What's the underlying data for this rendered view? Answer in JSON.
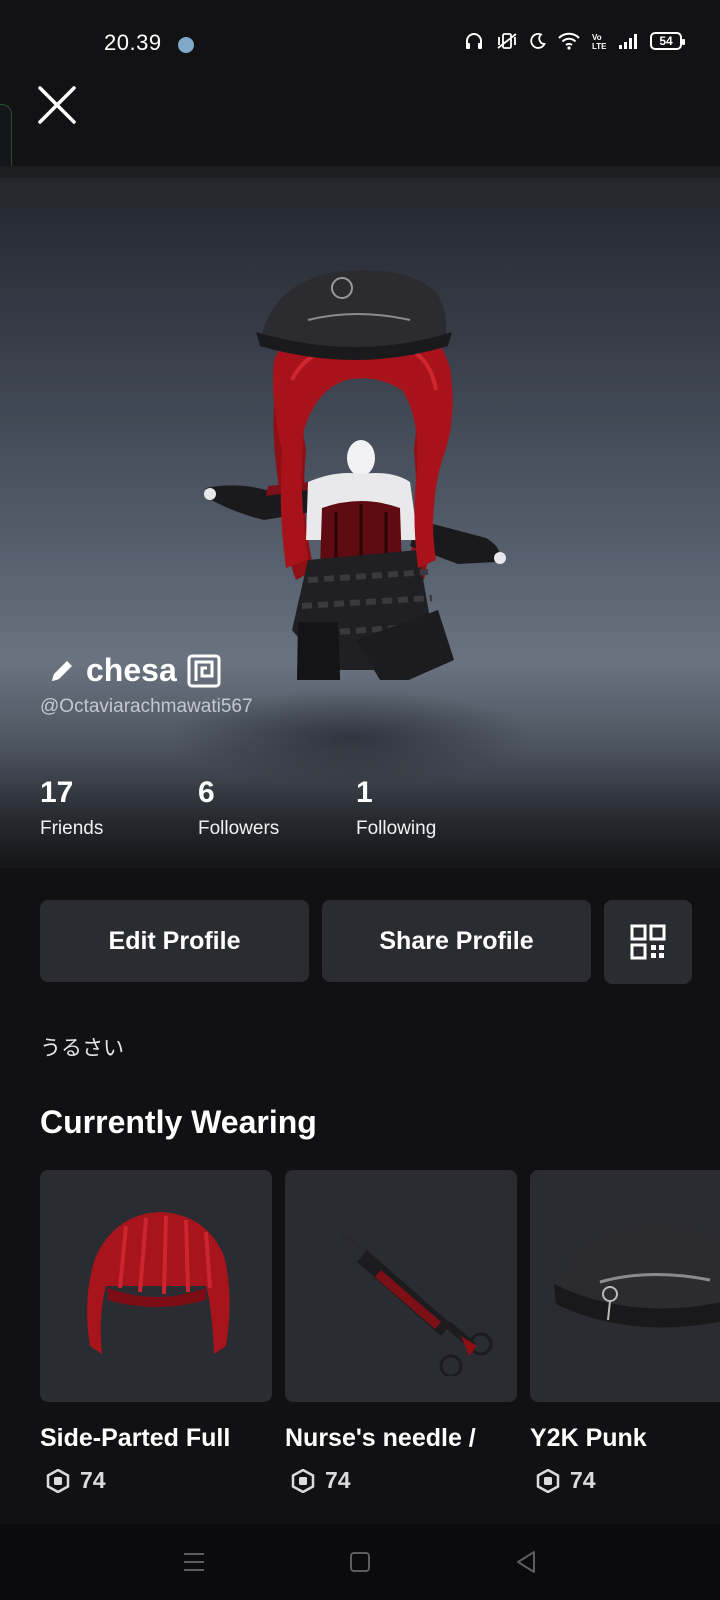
{
  "status_bar": {
    "time": "20.39",
    "battery_level": "54",
    "icons": [
      "headphones-icon",
      "vibrate-icon",
      "moon-icon",
      "wifi-icon",
      "volte-icon",
      "signal-icon",
      "battery-icon"
    ]
  },
  "header": {
    "close_icon": "close-icon"
  },
  "profile": {
    "display_name": "chesa",
    "username": "@Octaviarachmawati567",
    "edit_name_icon": "pencil-icon",
    "badge_icon": "verified-badge-icon"
  },
  "stats": [
    {
      "value": "17",
      "label": "Friends"
    },
    {
      "value": "6",
      "label": "Followers"
    },
    {
      "value": "1",
      "label": "Following"
    }
  ],
  "actions": {
    "edit_profile": "Edit Profile",
    "share_profile": "Share Profile",
    "qr_icon": "qr-code-icon"
  },
  "bio": "うるさい",
  "currently_wearing": {
    "title": "Currently Wearing",
    "items": [
      {
        "name": "Side-Parted Full",
        "price": "74",
        "thumbnail": "red-hair"
      },
      {
        "name": "Nurse's needle /",
        "price": "74",
        "thumbnail": "syringe"
      },
      {
        "name": "Y2K Punk",
        "price": "74",
        "thumbnail": "black-cap"
      }
    ],
    "currency_icon": "robux-icon"
  },
  "navigation": {
    "buttons": [
      "recents-icon",
      "home-icon",
      "back-icon"
    ]
  },
  "colors": {
    "background": "#111114",
    "card": "#2a2c32",
    "hair_red": "#b0141c"
  }
}
